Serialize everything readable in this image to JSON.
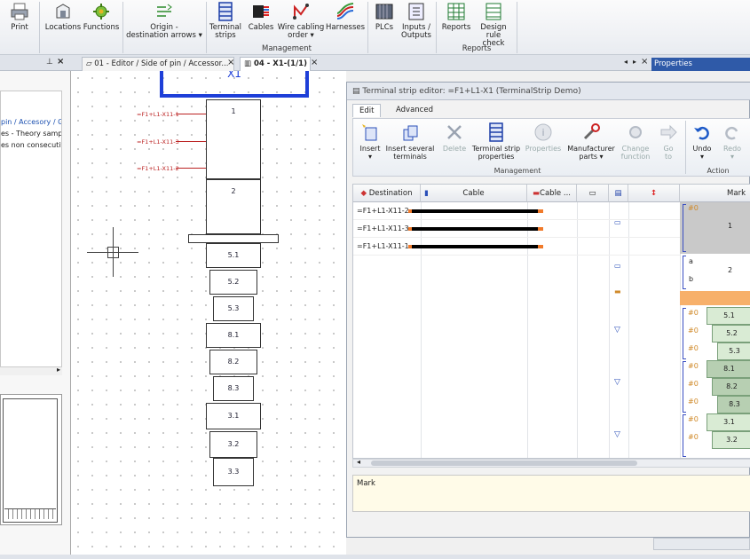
{
  "ribbon": {
    "buttons": [
      {
        "label": "Print",
        "icon": "print-icon"
      },
      {
        "label": "Locations",
        "icon": "locations-icon"
      },
      {
        "label": "Functions",
        "icon": "functions-icon"
      },
      {
        "label": "Origin -",
        "label2": "destination arrows",
        "icon": "origin-destination-icon"
      },
      {
        "label": "Terminal",
        "label2": "strips",
        "icon": "terminal-strips-icon"
      },
      {
        "label": "Cables",
        "icon": "cables-icon"
      },
      {
        "label": "Wire cabling",
        "label2": "order",
        "icon": "wire-cabling-icon"
      },
      {
        "label": "Harnesses",
        "icon": "harnesses-icon"
      },
      {
        "label": "PLCs",
        "icon": "plcs-icon"
      },
      {
        "label": "Inputs /",
        "label2": "Outputs",
        "icon": "inputs-outputs-icon"
      },
      {
        "label": "Reports",
        "icon": "reports-icon"
      },
      {
        "label": "Design",
        "label2": "rule check",
        "icon": "design-rule-check-icon"
      }
    ],
    "groups": {
      "management": "Management",
      "reports": "Reports"
    }
  },
  "tabs": {
    "tab1": "01 - Editor / Side of pin / Accessor...",
    "tab2": "04 - X1-(1/1)",
    "properties": "Properties"
  },
  "left_pane": {
    "line1": "pin / Accesory / G",
    "line2": "es - Theory sample",
    "line3": "es non consecutive"
  },
  "canvas": {
    "strip_label": "X1",
    "labels": [
      "=F1+L1-X11-1",
      "=F1+L1-X11-3",
      "=F1+L1-X11-2"
    ],
    "terminals": [
      "1",
      "2",
      "5.1",
      "5.2",
      "5.3",
      "8.1",
      "8.2",
      "8.3",
      "3.1",
      "3.2",
      "3.3"
    ],
    "bracket_a": "a",
    "bracket_b": "b"
  },
  "editor": {
    "title": "Terminal strip editor: =F1+L1-X1 (TerminalStrip Demo)",
    "tab_edit": "Edit",
    "tab_advanced": "Advanced",
    "buttons": {
      "insert": "Insert",
      "insert_several": "Insert several",
      "insert_several2": "terminals",
      "delete": "Delete",
      "ts_props": "Terminal strip",
      "ts_props2": "properties",
      "properties": "Properties",
      "manufacturer": "Manufacturer",
      "manufacturer2": "parts",
      "change": "Change",
      "change2": "function",
      "goto": "Go",
      "goto2": "to",
      "undo": "Undo",
      "redo": "Redo"
    },
    "group_management": "Management",
    "group_action": "Action",
    "columns": {
      "destination": "Destination",
      "cable": "Cable",
      "cable2": "Cable ...",
      "mark": "Mark"
    },
    "rows": [
      "=F1+L1-X11-2",
      "=F1+L1-X11-3",
      "=F1+L1-X11-1"
    ],
    "mark_hash": "#0",
    "marks": {
      "m1": "1",
      "m2": "2",
      "ma": "a",
      "mb": "b"
    },
    "mark_pills": [
      "5.1",
      "5.2",
      "5.3",
      "8.1",
      "8.2",
      "8.3",
      "3.1",
      "3.2"
    ],
    "note": "Mark"
  },
  "colors": {
    "accent": "#1e3fd8",
    "cable": "#f07a2b",
    "pill": "#d9ebd4"
  }
}
